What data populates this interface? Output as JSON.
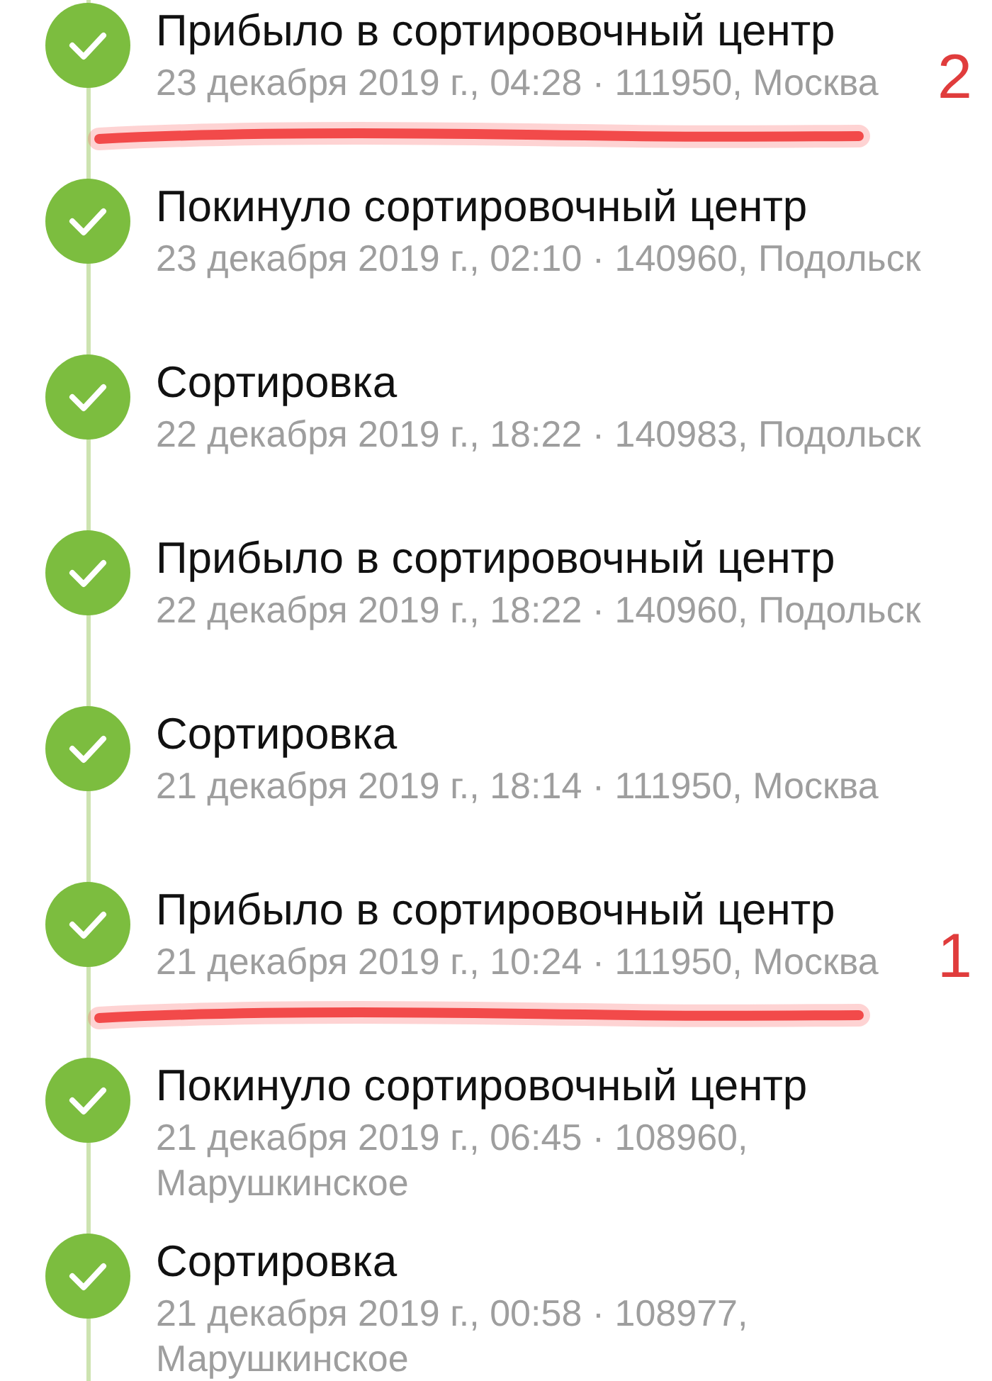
{
  "events": [
    {
      "title": "Прибыло в сортировочный центр",
      "details": "23 декабря 2019 г., 04:28 · 111950, Москва",
      "done": true,
      "annotation": "2"
    },
    {
      "title": "Покинуло сортировочный центр",
      "details": "23 декабря 2019 г., 02:10 · 140960, Подольск",
      "done": true
    },
    {
      "title": "Сортировка",
      "details": "22 декабря 2019 г., 18:22 · 140983, Подольск",
      "done": true
    },
    {
      "title": "Прибыло в сортировочный центр",
      "details": "22 декабря 2019 г., 18:22 · 140960, Подольск",
      "done": true
    },
    {
      "title": "Сортировка",
      "details": "21 декабря 2019 г., 18:14 · 111950, Москва",
      "done": true
    },
    {
      "title": "Прибыло в сортировочный центр",
      "details": "21 декабря 2019 г., 10:24 · 111950, Москва",
      "done": true,
      "annotation": "1"
    },
    {
      "title": "Покинуло сортировочный центр",
      "details": "21 декабря 2019 г., 06:45 · 108960, Марушкинское",
      "done": true
    },
    {
      "title": "Сортировка",
      "details": "21 декабря 2019 г., 00:58 · 108977, Марушкинское",
      "done": true
    }
  ]
}
